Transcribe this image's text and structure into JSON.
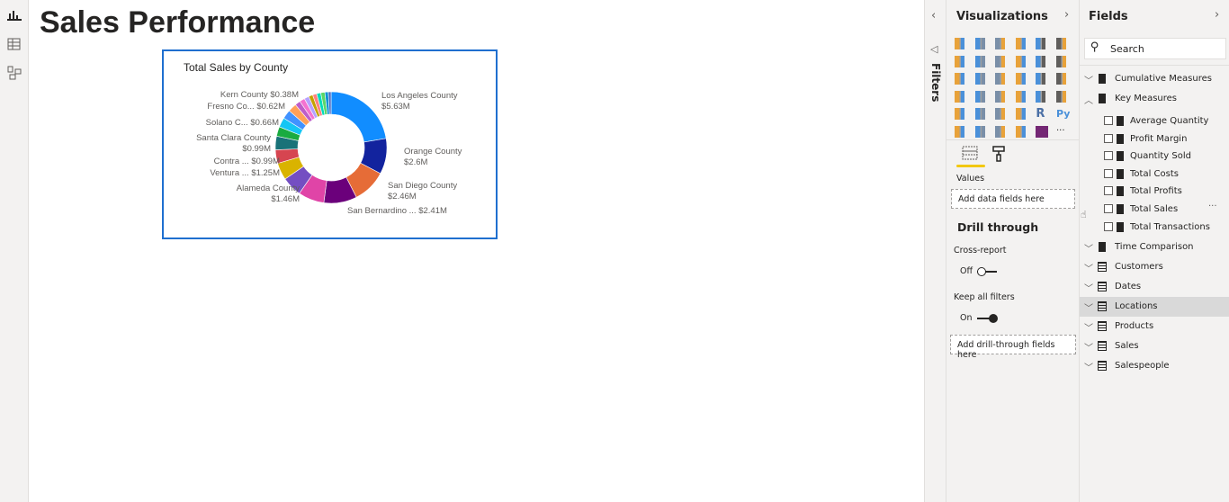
{
  "page": {
    "title": "Sales Performance"
  },
  "visual": {
    "title": "Total Sales by County",
    "chart_data": {
      "type": "pie",
      "subtype": "donut",
      "title": "Total Sales by County",
      "slices": [
        {
          "label": "Los Angeles County",
          "value": 5.63,
          "display": "$5.63M",
          "color": "#118dff"
        },
        {
          "label": "Orange County",
          "value": 2.6,
          "display": "$2.6M",
          "color": "#12239e"
        },
        {
          "label": "San Diego County",
          "value": 2.46,
          "display": "$2.46M",
          "color": "#e66c37"
        },
        {
          "label": "San Bernardino ...",
          "value": 2.41,
          "display": "$2.41M",
          "color": "#6b007b"
        },
        {
          "label": "",
          "value": 1.9,
          "display": "",
          "color": "#e044a7"
        },
        {
          "label": "Alameda County",
          "value": 1.46,
          "display": "$1.46M",
          "color": "#744ec2"
        },
        {
          "label": "Ventura ...",
          "value": 1.25,
          "display": "$1.25M",
          "color": "#d9b300"
        },
        {
          "label": "Contra ...",
          "value": 0.99,
          "display": "$0.99M",
          "color": "#d64550"
        },
        {
          "label": "Santa Clara County",
          "value": 0.99,
          "display": "$0.99M",
          "color": "#197278"
        },
        {
          "label": "",
          "value": 0.7,
          "display": "",
          "color": "#1aab40"
        },
        {
          "label": "",
          "value": 0.7,
          "display": "",
          "color": "#15c6f4"
        },
        {
          "label": "Solano C...",
          "value": 0.66,
          "display": "$0.66M",
          "color": "#4092ff"
        },
        {
          "label": "Fresno Co...",
          "value": 0.62,
          "display": "$0.62M",
          "color": "#ffa058"
        },
        {
          "label": "",
          "value": 0.4,
          "display": "",
          "color": "#be5dc9"
        },
        {
          "label": "Kern County",
          "value": 0.38,
          "display": "$0.38M",
          "color": "#f472d0"
        },
        {
          "label": "",
          "value": 0.35,
          "display": "",
          "color": "#b5a1ff"
        },
        {
          "label": "",
          "value": 0.3,
          "display": "",
          "color": "#c4a200"
        },
        {
          "label": "",
          "value": 0.3,
          "display": "",
          "color": "#ff8080"
        },
        {
          "label": "",
          "value": 0.3,
          "display": "",
          "color": "#00dbbc"
        },
        {
          "label": "",
          "value": 0.3,
          "display": "",
          "color": "#5bd667"
        },
        {
          "label": "",
          "value": 0.25,
          "display": "",
          "color": "#0091d5"
        },
        {
          "label": "",
          "value": 0.2,
          "display": "",
          "color": "#4668c5"
        }
      ]
    }
  },
  "filters": {
    "label": "Filters"
  },
  "visualizations": {
    "title": "Visualizations",
    "icons": [
      "stacked-bar",
      "stacked-column",
      "clustered-bar",
      "clustered-column",
      "100-bar",
      "100-column",
      "line",
      "area",
      "stacked-area",
      "line-column",
      "line-clustered-column",
      "ribbon",
      "waterfall",
      "funnel",
      "scatter",
      "pie",
      "donut",
      "treemap",
      "map",
      "filled-map",
      "shape-map",
      "gauge",
      "card",
      "multi-row-card",
      "kpi",
      "slicer",
      "table",
      "matrix",
      "r-visual",
      "python-visual",
      "key-influencers",
      "decomposition-tree",
      "qa",
      "arcgis",
      "power-apps",
      "more"
    ],
    "values_label": "Values",
    "values_placeholder": "Add data fields here",
    "drill_title": "Drill through",
    "cross_report": "Cross-report",
    "cross_state": "Off",
    "keep_filters": "Keep all filters",
    "keep_state": "On",
    "drill_placeholder": "Add drill-through fields here"
  },
  "fields": {
    "title": "Fields",
    "search_placeholder": "Search",
    "groups": [
      {
        "name": "Cumulative Measures",
        "expanded": false,
        "type": "measures"
      },
      {
        "name": "Key Measures",
        "expanded": true,
        "type": "measures",
        "items": [
          "Average Quantity",
          "Profit Margin",
          "Quantity Sold",
          "Total Costs",
          "Total Profits",
          "Total Sales",
          "Total Transactions"
        ]
      },
      {
        "name": "Time Comparison",
        "expanded": false,
        "type": "measures"
      },
      {
        "name": "Customers",
        "expanded": false,
        "type": "table"
      },
      {
        "name": "Dates",
        "expanded": false,
        "type": "table"
      },
      {
        "name": "Locations",
        "expanded": false,
        "type": "table",
        "selected": true
      },
      {
        "name": "Products",
        "expanded": false,
        "type": "table"
      },
      {
        "name": "Sales",
        "expanded": false,
        "type": "table"
      },
      {
        "name": "Salespeople",
        "expanded": false,
        "type": "table"
      }
    ],
    "more_label": "···"
  }
}
